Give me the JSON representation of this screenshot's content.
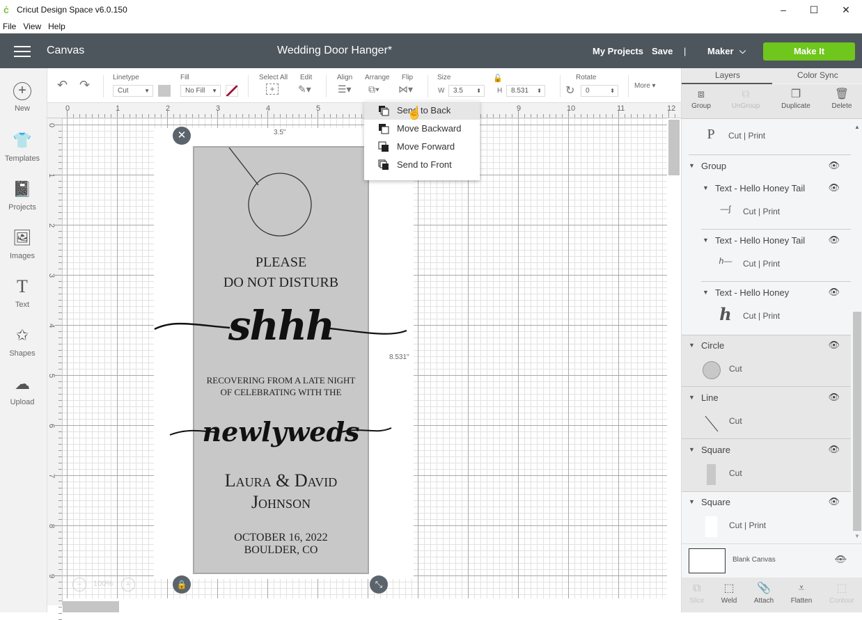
{
  "window": {
    "title": "Cricut Design Space  v6.0.150",
    "controls": {
      "minimize": "–",
      "maximize": "☐",
      "close": "✕"
    }
  },
  "menubar": {
    "items": [
      "File",
      "View",
      "Help"
    ]
  },
  "header": {
    "section": "Canvas",
    "project_title": "Wedding Door Hanger*",
    "my_projects": "My Projects",
    "save": "Save",
    "divider": "|",
    "machine": "Maker",
    "make_it": "Make It",
    "accent_color": "#6fc61c"
  },
  "sidebar": {
    "items": [
      {
        "label": "New",
        "icon": "plus-circle-icon"
      },
      {
        "label": "Templates",
        "icon": "shirt-icon"
      },
      {
        "label": "Projects",
        "icon": "notebook-icon"
      },
      {
        "label": "Images",
        "icon": "image-icon"
      },
      {
        "label": "Text",
        "icon": "text-icon"
      },
      {
        "label": "Shapes",
        "icon": "shapes-icon"
      },
      {
        "label": "Upload",
        "icon": "cloud-upload-icon"
      }
    ]
  },
  "toolbar": {
    "undo": "undo",
    "redo": "redo",
    "linetype_label": "Linetype",
    "linetype_value": "Cut",
    "fill_label": "Fill",
    "fill_value": "No Fill",
    "select_all_label": "Select All",
    "edit_label": "Edit",
    "align_label": "Align",
    "arrange_label": "Arrange",
    "flip_label": "Flip",
    "size_label": "Size",
    "w_label": "W",
    "w_value": "3.5",
    "h_label": "H",
    "h_value": "8.531",
    "rotate_label": "Rotate",
    "rotate_value": "0",
    "more_label": "More ▾"
  },
  "ruler": {
    "top": [
      "0",
      "1",
      "2",
      "3",
      "4",
      "5",
      "6",
      "7",
      "8",
      "9",
      "10",
      "11",
      "12"
    ],
    "left": [
      "0",
      "1",
      "2",
      "3",
      "4",
      "5",
      "6",
      "7",
      "8",
      "9"
    ]
  },
  "arrange_menu": {
    "items": [
      "Send to Back",
      "Move Backward",
      "Move Forward",
      "Send to Front"
    ],
    "hovered_index": 0
  },
  "design": {
    "width_label": "3.5\"",
    "height_label": "8.531\"",
    "lines": {
      "please": "PLEASE",
      "dnd": "DO NOT DISTURB",
      "shhh": "shhh",
      "recovering1": "RECOVERING FROM A LATE NIGHT",
      "recovering2": "OF CELEBRATING WITH THE",
      "newlyweds": "newlyweds",
      "names1": "Laura & David",
      "names2": "Johnson",
      "date": "OCTOBER 16, 2022",
      "place": "BOULDER, CO"
    }
  },
  "zoom": {
    "value": "100%",
    "minus": "−",
    "plus": "+"
  },
  "layers_panel": {
    "tabs": [
      "Layers",
      "Color Sync"
    ],
    "active_tab": "Layers",
    "tools": [
      {
        "label": "Group",
        "enabled": true
      },
      {
        "label": "UnGroup",
        "enabled": false
      },
      {
        "label": "Duplicate",
        "enabled": true
      },
      {
        "label": "Delete",
        "enabled": true
      }
    ],
    "top_item": {
      "thumb": "P",
      "ops": "Cut | Print"
    },
    "group": {
      "name": "Group"
    },
    "group_children": [
      {
        "name": "Text - Hello Honey Tail",
        "ops": "Cut | Print",
        "thumb": "—ʃ"
      },
      {
        "name": "Text - Hello Honey Tail",
        "ops": "Cut | Print",
        "thumb": "h—"
      },
      {
        "name": "Text - Hello Honey",
        "ops": "Cut | Print",
        "thumb": "h"
      }
    ],
    "layers": [
      {
        "name": "Circle",
        "ops": "Cut"
      },
      {
        "name": "Line",
        "ops": "Cut"
      },
      {
        "name": "Square",
        "ops": "Cut"
      },
      {
        "name": "Square",
        "ops": "Cut | Print"
      }
    ],
    "blank_canvas": "Blank Canvas",
    "bottom_tools": [
      {
        "label": "Slice",
        "enabled": false
      },
      {
        "label": "Weld",
        "enabled": true
      },
      {
        "label": "Attach",
        "enabled": true
      },
      {
        "label": "Flatten",
        "enabled": true
      },
      {
        "label": "Contour",
        "enabled": false
      }
    ]
  }
}
